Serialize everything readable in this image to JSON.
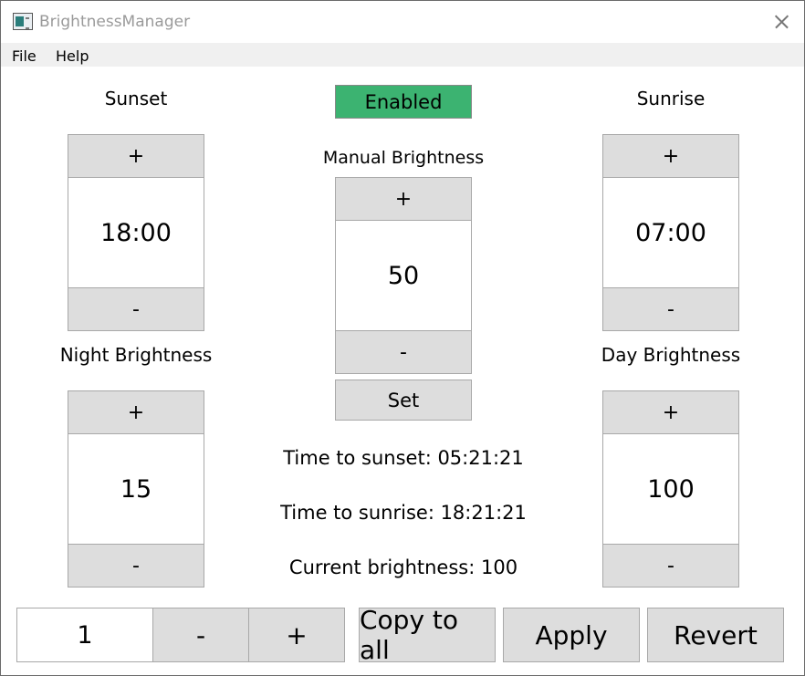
{
  "window": {
    "title": "BrightnessManager"
  },
  "menu": {
    "items": [
      {
        "label": "File"
      },
      {
        "label": "Help"
      }
    ]
  },
  "status": {
    "enabled_label": "Enabled",
    "enabled_color": "#3cb371"
  },
  "sunset": {
    "label": "Sunset",
    "plus": "+",
    "value": "18:00",
    "minus": "-"
  },
  "sunrise": {
    "label": "Sunrise",
    "plus": "+",
    "value": "07:00",
    "minus": "-"
  },
  "manual": {
    "label": "Manual Brightness",
    "plus": "+",
    "value": "50",
    "minus": "-",
    "set_label": "Set"
  },
  "night": {
    "label": "Night Brightness",
    "plus": "+",
    "value": "15",
    "minus": "-"
  },
  "day": {
    "label": "Day Brightness",
    "plus": "+",
    "value": "100",
    "minus": "-"
  },
  "info": {
    "time_to_sunset": "Time to sunset: 05:21:21",
    "time_to_sunrise": "Time to sunrise: 18:21:21",
    "current_brightness": "Current brightness: 100"
  },
  "bottom": {
    "value": "1",
    "minus": "-",
    "plus": "+",
    "copy_to_all": "Copy to all",
    "apply": "Apply",
    "revert": "Revert"
  },
  "icons": {
    "app": "app-window-icon",
    "close": "close-icon"
  }
}
